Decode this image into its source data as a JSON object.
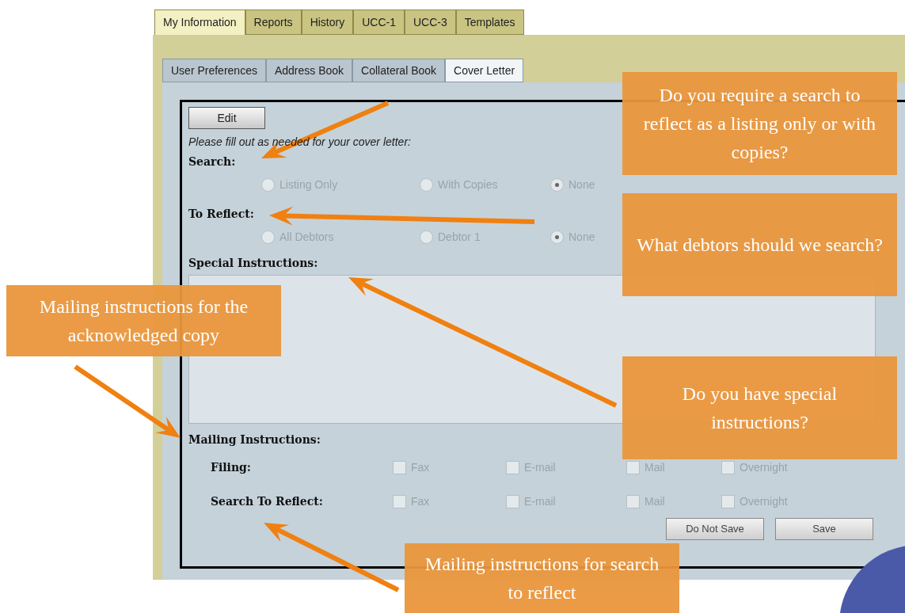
{
  "main_tabs": [
    {
      "label": "My Information",
      "selected": true
    },
    {
      "label": "Reports",
      "selected": false
    },
    {
      "label": "History",
      "selected": false
    },
    {
      "label": "UCC-1",
      "selected": false
    },
    {
      "label": "UCC-3",
      "selected": false
    },
    {
      "label": "Templates",
      "selected": false
    }
  ],
  "sub_tabs": [
    {
      "label": "User Preferences",
      "selected": false
    },
    {
      "label": "Address Book",
      "selected": false
    },
    {
      "label": "Collateral Book",
      "selected": false
    },
    {
      "label": "Cover Letter",
      "selected": true
    }
  ],
  "edit_button": "Edit",
  "instructions": "Please fill out as needed for your cover letter:",
  "radio_groups": [
    {
      "label": "Search:",
      "disabled": true,
      "options": [
        {
          "label": "Listing Only",
          "selected": false
        },
        {
          "label": "With Copies",
          "selected": false
        },
        {
          "label": "None",
          "selected": true
        }
      ]
    },
    {
      "label": "To Reflect:",
      "disabled": true,
      "options": [
        {
          "label": "All Debtors",
          "selected": false
        },
        {
          "label": "Debtor 1",
          "selected": false
        },
        {
          "label": "None",
          "selected": true
        }
      ]
    }
  ],
  "special_instructions": {
    "label": "Special Instructions:"
  },
  "mailing": {
    "label": "Mailing Instructions:",
    "rows": [
      {
        "label": "Filing:",
        "disabled": true,
        "options": [
          {
            "label": "Fax",
            "checked": false
          },
          {
            "label": "E-mail",
            "checked": false
          },
          {
            "label": "Mail",
            "checked": false
          },
          {
            "label": "Overnight",
            "checked": false
          }
        ]
      },
      {
        "label": "Search To Reflect:",
        "disabled": true,
        "options": [
          {
            "label": "Fax",
            "checked": false
          },
          {
            "label": "E-mail",
            "checked": false
          },
          {
            "label": "Mail",
            "checked": false
          },
          {
            "label": "Overnight",
            "checked": false
          }
        ]
      }
    ]
  },
  "buttons": [
    "Do Not Save",
    "Save"
  ],
  "callouts": [
    "Do you require a search to reflect as a listing only or with copies?",
    "What debtors should we search?",
    "Mailing instructions for the acknowledged copy",
    "Do you have special instructions?",
    "Mailing instructions for search to reflect"
  ]
}
